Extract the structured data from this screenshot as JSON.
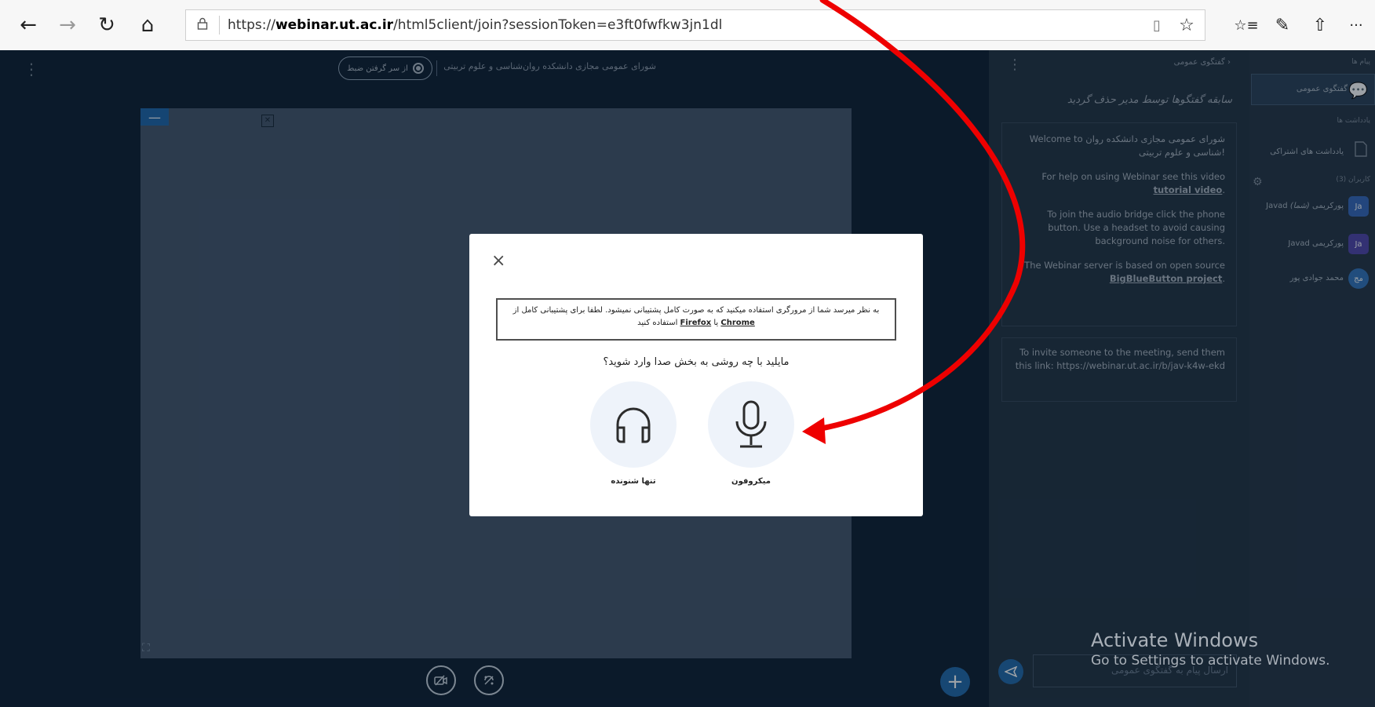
{
  "browser": {
    "url_prefix": "https://",
    "url_host": "webinar.ut.ac.ir",
    "url_path": "/html5client/join?sessionToken=e3ft0fwfkw3jn1dl",
    "icons": {
      "back": "←",
      "forward": "→",
      "refresh": "↻",
      "home": "⌂",
      "lock": "🔒",
      "reading_view": "▯",
      "favorite": "☆",
      "favorites_list": "☆≡",
      "pen": "✎",
      "share": "⇧",
      "more": "···"
    }
  },
  "presentation": {
    "meeting_title": "شورای عمومی مجازی دانشکده روان‌شناسی و علوم تربیتی",
    "record_label": "از سر گرفتن ضبط",
    "minimize_symbol": "—",
    "add_symbol": "+"
  },
  "chat": {
    "header_title": "گفتگوی عمومی",
    "cleared_message": "سابقه گفتگوها توسط مدیر حذف گردید",
    "welcome_1": "Welcome to شورای عمومی مجازی دانشکده روان شناسی و علوم تربیتی!",
    "help_prefix": "For help on using Webinar see this video ",
    "help_link": "tutorial video",
    "help_suffix": ".",
    "audio_help": "To join the audio bridge click the phone button. Use a headset to avoid causing background noise for others.",
    "server_prefix": "The Webinar server is based on open source ",
    "server_link": "BigBlueButton project",
    "server_suffix": ".",
    "invite_text": "To invite someone to the meeting, send them this link: https://webinar.ut.ac.ir/b/jav-k4w-ekd",
    "input_placeholder": "ارسال پیام به گفتگوی عمومی"
  },
  "userlist": {
    "messages_header": "پیام ها",
    "public_chat": "گفتگوی عمومی",
    "notes_header": "یادداشت ها",
    "shared_notes": "یادداشت های اشتراکی",
    "users_header": "کاربران (3)",
    "users": [
      {
        "initials": "Ja",
        "name": "Javad پورکریمی",
        "suffix": "(شما)",
        "color": "#2f63b8"
      },
      {
        "initials": "Ja",
        "name": "Javad پورکریمی",
        "suffix": "",
        "color": "#4a3fa8"
      },
      {
        "initials": "مج",
        "name": "محمد جوادی پور",
        "suffix": "",
        "color": "#2c6fb8"
      }
    ]
  },
  "modal": {
    "close_symbol": "×",
    "warning_line1": "به نظر میرسد شما از مرورگری استفاده میکنید که به صورت کامل پشتیبانی نمیشود. لطفا برای پشتیبانی کامل از",
    "warning_chrome": "Chrome",
    "warning_or": " یا ",
    "warning_firefox": "Firefox",
    "warning_end": " استفاده کنید",
    "question": "مایلید با چه روشی به بخش صدا وارد شوید؟",
    "microphone_label": "میکروفون",
    "listen_only_label": "تنها شنونده"
  },
  "colors": {
    "annotation_arrow": "#ee0000",
    "accent": "#1b64a8"
  },
  "watermark": {
    "title": "Activate Windows",
    "subtitle": "Go to Settings to activate Windows."
  }
}
